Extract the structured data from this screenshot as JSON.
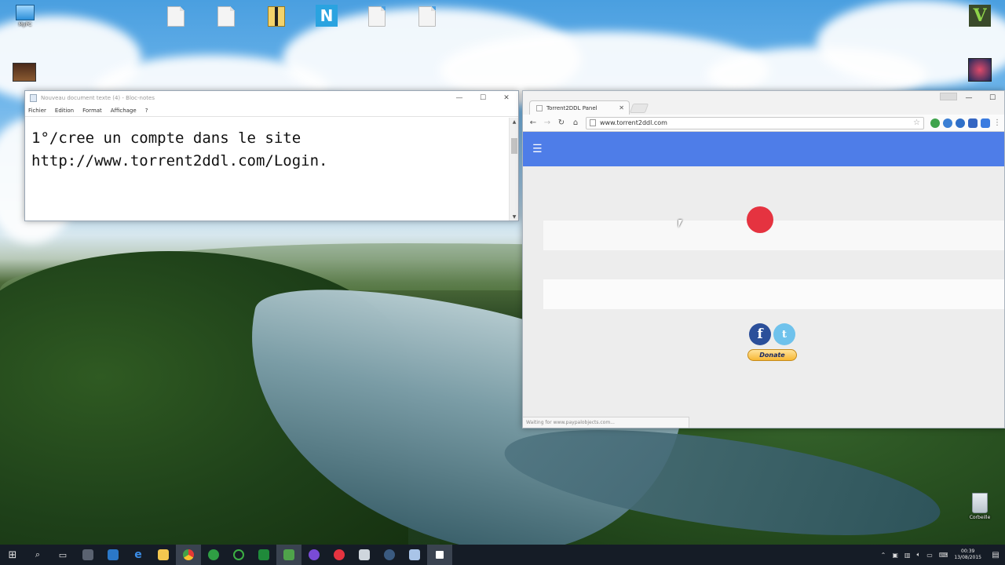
{
  "desktop": {
    "icons": [
      {
        "label": "MyPC",
        "kind": "pc"
      },
      {
        "label": "",
        "kind": "doc"
      },
      {
        "label": "",
        "kind": "doc"
      },
      {
        "label": "",
        "kind": "doc"
      },
      {
        "label": "",
        "kind": "zip"
      },
      {
        "label": "",
        "kind": "app"
      },
      {
        "label": "",
        "kind": "doc"
      },
      {
        "label": "",
        "kind": "doc"
      },
      {
        "label": "",
        "kind": "app"
      },
      {
        "label": "",
        "kind": "app"
      },
      {
        "label": "Corbeille",
        "kind": "bin"
      }
    ]
  },
  "notepad": {
    "title": "Nouveau document texte (4) - Bloc-notes",
    "menu": [
      "Fichier",
      "Edition",
      "Format",
      "Affichage",
      "?"
    ],
    "content": "1°/cree un compte dans le site\nhttp://www.torrent2ddl.com/Login."
  },
  "chrome": {
    "tab_title": "Torrent2DDL Panel",
    "url": "www.torrent2ddl.com",
    "status_text": "Waiting for www.paypalobjects.com...",
    "donate_label": "Donate",
    "colors": {
      "appbar": "#4e7de8",
      "record_dot": "#e53340"
    }
  },
  "taskbar": {
    "clock_time": "00:39",
    "clock_date": "13/08/2015"
  }
}
